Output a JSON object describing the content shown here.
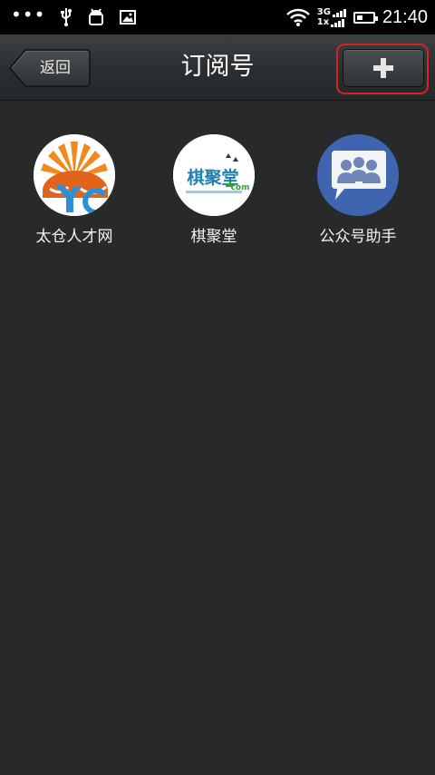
{
  "status_bar": {
    "dots": "•••",
    "network_top": "3G",
    "network_bottom": "1x",
    "time": "21:40",
    "battery_level": 0.4,
    "icons": [
      "usb-icon",
      "android-debug-icon",
      "image-icon",
      "wifi-icon",
      "signal-icon",
      "battery-icon"
    ]
  },
  "header": {
    "back_label": "返回",
    "title": "订阅号",
    "add_icon": "plus-icon",
    "highlight_color": "#d42323"
  },
  "subscriptions": [
    {
      "name": "太仓人才网",
      "icon": "taicang-logo-icon"
    },
    {
      "name": "棋聚堂",
      "icon": "qijutang-logo-icon",
      "logo_text": "棋聚堂",
      "logo_suffix": "com"
    },
    {
      "name": "公众号助手",
      "icon": "assistant-people-icon"
    }
  ]
}
